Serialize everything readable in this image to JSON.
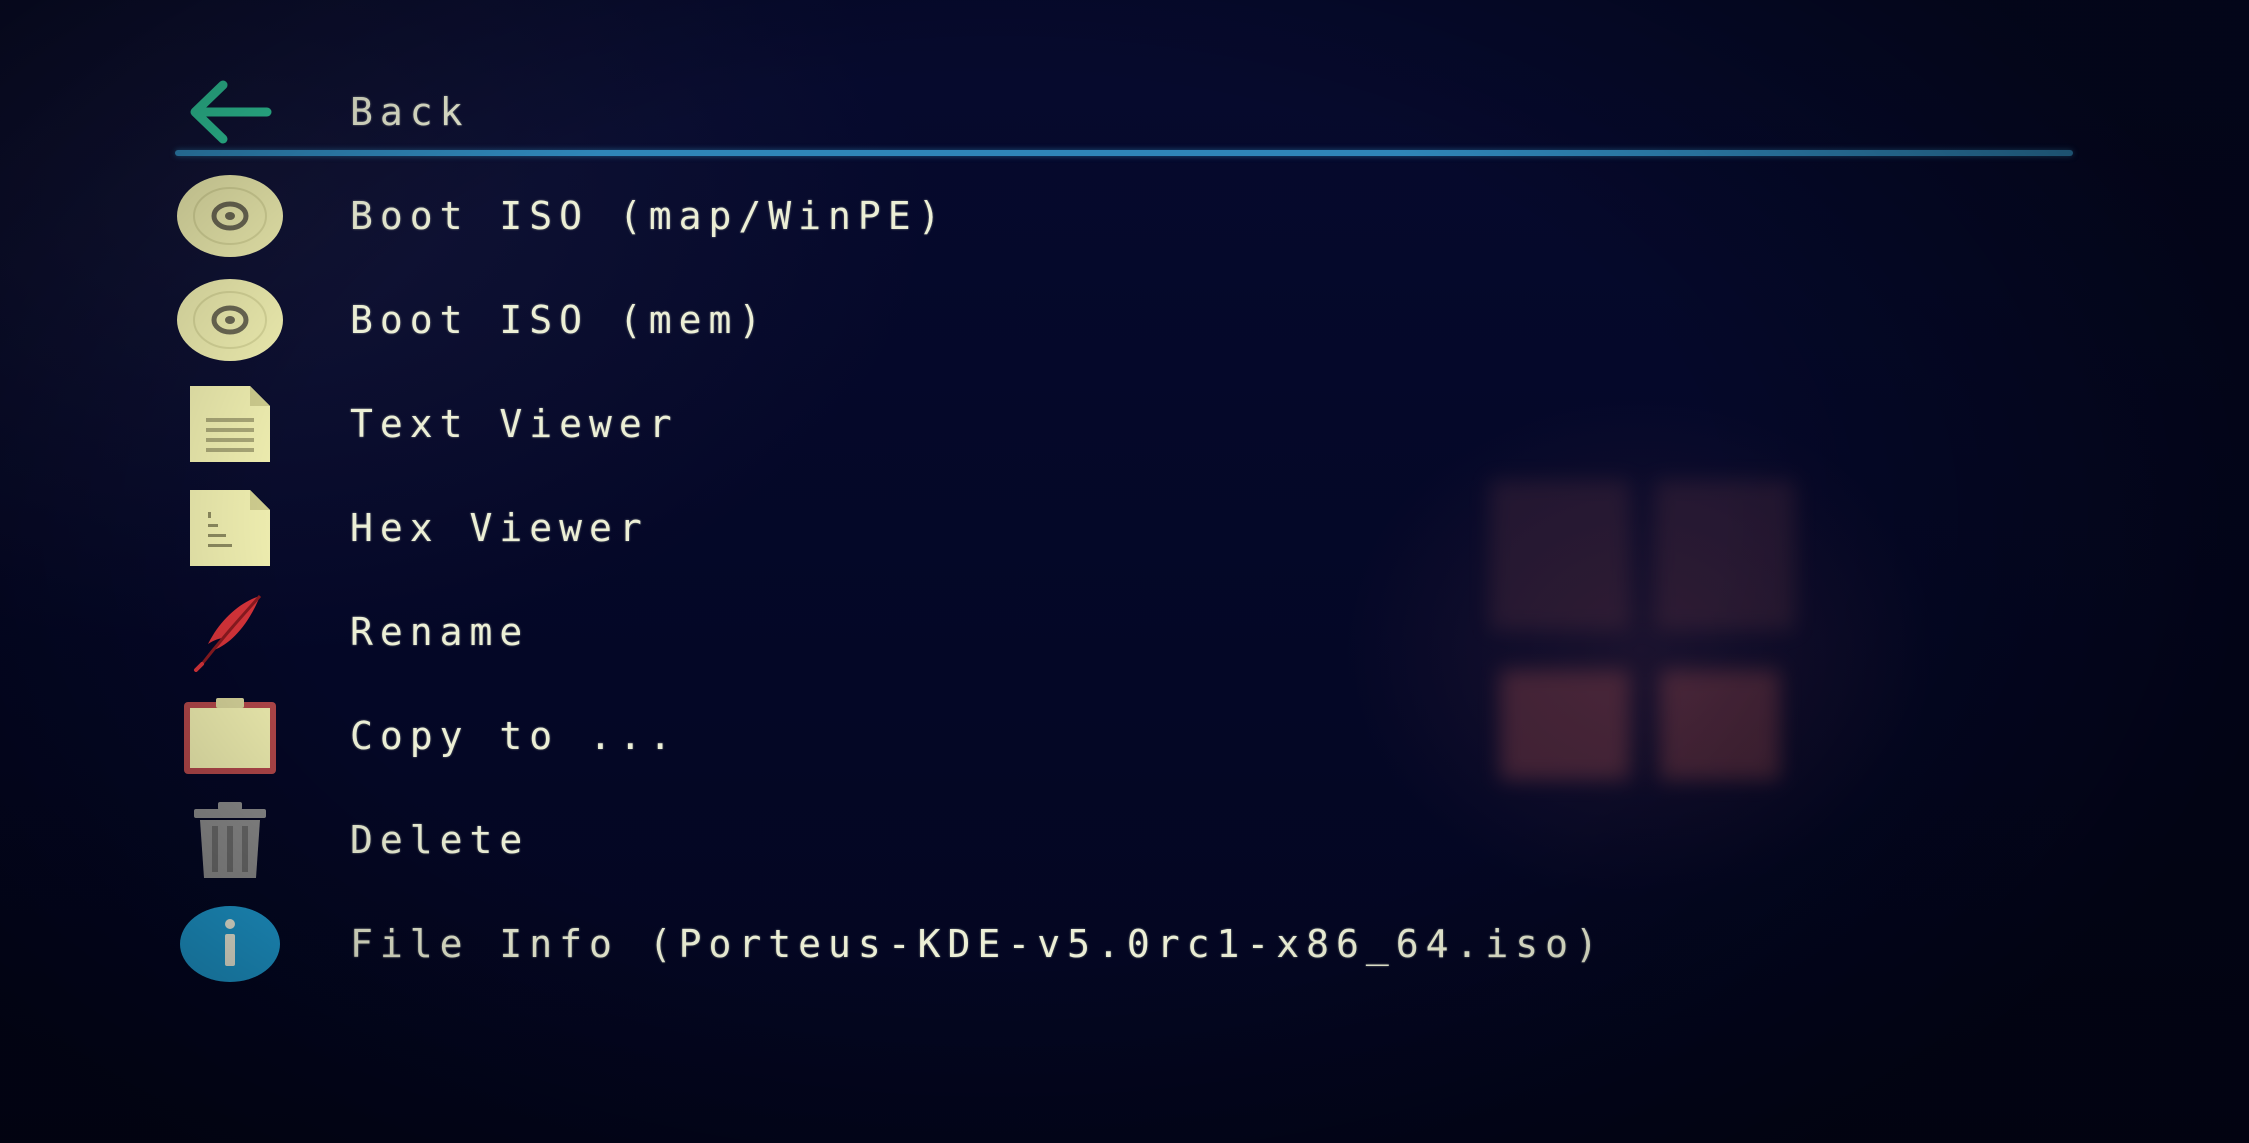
{
  "menu": {
    "back_label": "Back",
    "items": [
      {
        "label": "Boot ISO (map/WinPE)",
        "icon": "disc-icon"
      },
      {
        "label": "Boot ISO (mem)",
        "icon": "disc-icon"
      },
      {
        "label": "Text Viewer",
        "icon": "text-file-icon"
      },
      {
        "label": "Hex Viewer",
        "icon": "hex-file-icon"
      },
      {
        "label": "Rename",
        "icon": "feather-pen-icon"
      },
      {
        "label": "Copy to ...",
        "icon": "clipboard-icon"
      },
      {
        "label": "Delete",
        "icon": "trash-icon"
      },
      {
        "label": "File Info (Porteus-KDE-v5.0rc1-x86_64.iso)",
        "icon": "info-icon"
      }
    ]
  },
  "colors": {
    "background": "#04082a",
    "text": "#ecefd6",
    "separator": "#2f86b8",
    "back_arrow": "#2fc79a",
    "icon_cream": "#efeeb0",
    "info_blue": "#1e9ad0"
  }
}
